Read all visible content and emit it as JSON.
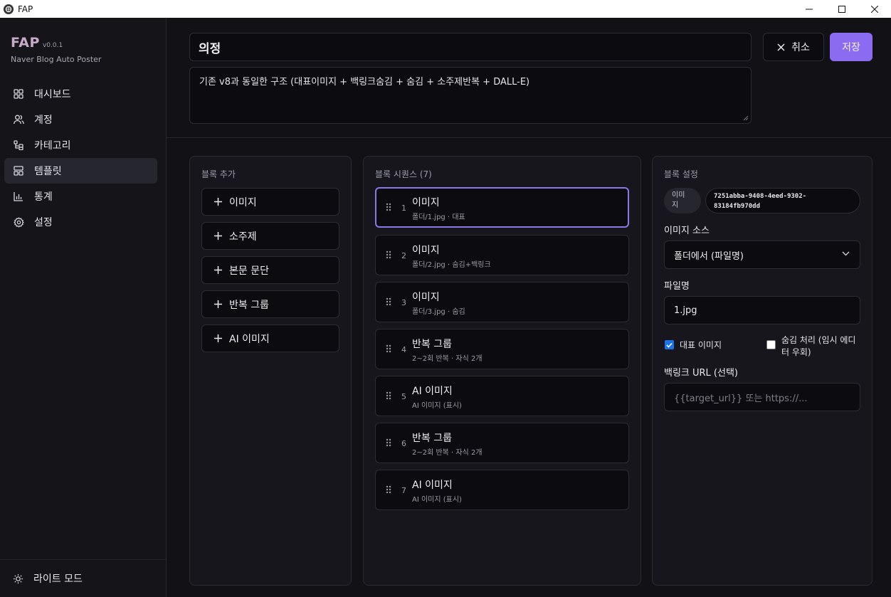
{
  "window": {
    "title": "FAP"
  },
  "brand": {
    "name": "FAP",
    "version": "v0.0.1",
    "subtitle": "Naver Blog Auto Poster"
  },
  "sidebar": {
    "items": [
      {
        "label": "대시보드",
        "icon": "dashboard-icon"
      },
      {
        "label": "계정",
        "icon": "users-icon"
      },
      {
        "label": "카테고리",
        "icon": "category-tree-icon"
      },
      {
        "label": "템플릿",
        "icon": "template-icon",
        "active": true
      },
      {
        "label": "통계",
        "icon": "bar-chart-icon"
      },
      {
        "label": "설정",
        "icon": "gear-icon"
      }
    ],
    "theme_toggle": "라이트 모드"
  },
  "header": {
    "title_value": "의정",
    "description_value": "기존 v8과 동일한 구조 (대표이미지 + 백링크숨김 + 숨김 + 소주제반복 + DALL-E)",
    "cancel_label": "취소",
    "save_label": "저장"
  },
  "add_panel": {
    "title": "블록 추가",
    "buttons": [
      "이미지",
      "소주제",
      "본문 문단",
      "반복 그룹",
      "AI 이미지"
    ]
  },
  "sequence_panel": {
    "title": "블록 시퀀스 (7)",
    "blocks": [
      {
        "num": "1",
        "title": "이미지",
        "sub": "폴더/1.jpg · 대표",
        "selected": true
      },
      {
        "num": "2",
        "title": "이미지",
        "sub": "폴더/2.jpg · 숨김+백링크"
      },
      {
        "num": "3",
        "title": "이미지",
        "sub": "폴더/3.jpg · 숨김"
      },
      {
        "num": "4",
        "title": "반복 그룹",
        "sub": "2~2회 반복 · 자식 2개"
      },
      {
        "num": "5",
        "title": "AI 이미지",
        "sub": "AI 이미지 (표시)"
      },
      {
        "num": "6",
        "title": "반복 그룹",
        "sub": "2~2회 반복 · 자식 2개"
      },
      {
        "num": "7",
        "title": "AI 이미지",
        "sub": "AI 이미지 (표시)"
      }
    ]
  },
  "settings_panel": {
    "title": "블록 설정",
    "type_badge_line1": "이미",
    "type_badge_line2": "지",
    "block_id_line1": "7251abba-9408-4eed-9302-",
    "block_id_line2": "83184fb970dd",
    "source_label": "이미지 소스",
    "source_value": "폴더에서 (파일명)",
    "filename_label": "파일명",
    "filename_value": "1.jpg",
    "thumbnail_label": "대표 이미지",
    "thumbnail_checked": true,
    "hide_label_line1": "숨김 처리 (임시 에디",
    "hide_label_line2": "터 우회)",
    "hide_checked": false,
    "backlink_label": "백링크 URL (선택)",
    "backlink_placeholder": "{{target_url}} 또는 https://..."
  },
  "colors": {
    "accent": "#8b6cf0",
    "selected_border": "#8b78e6",
    "checkbox": "#1a73e8"
  }
}
